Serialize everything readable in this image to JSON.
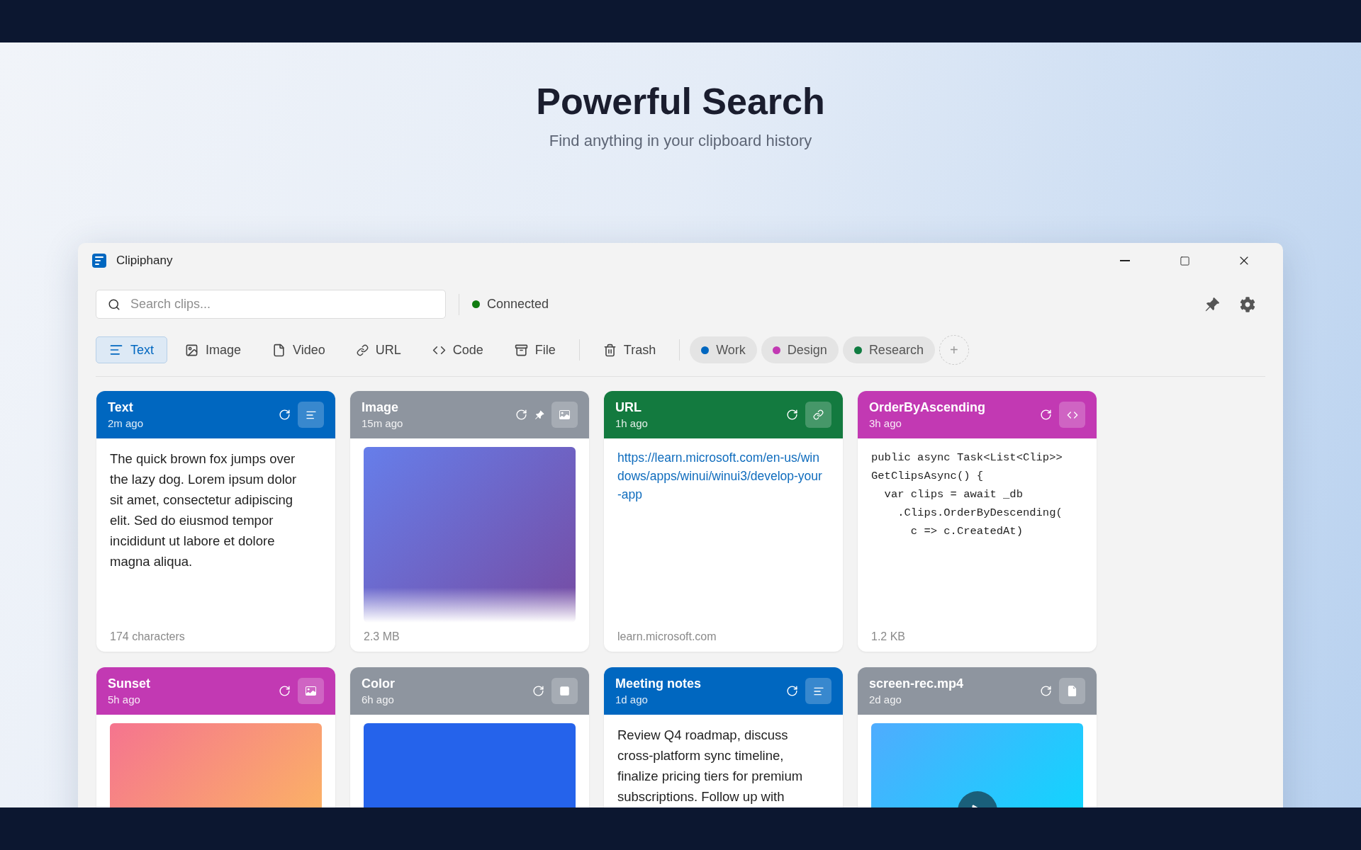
{
  "hero": {
    "title": "Powerful Search",
    "subtitle": "Find anything in your clipboard history"
  },
  "window": {
    "title": "Clipiphany"
  },
  "search": {
    "placeholder": "Search clips..."
  },
  "status": {
    "label": "Connected",
    "connected": true
  },
  "filters": [
    {
      "label": "Text",
      "kind": "text",
      "selected": true
    },
    {
      "label": "Image",
      "kind": "image",
      "selected": false
    },
    {
      "label": "Video",
      "kind": "video",
      "selected": false
    },
    {
      "label": "URL",
      "kind": "url",
      "selected": false
    },
    {
      "label": "Code",
      "kind": "code",
      "selected": false
    },
    {
      "label": "File",
      "kind": "file",
      "selected": false
    }
  ],
  "trash": {
    "label": "Trash",
    "selected": false
  },
  "tags": [
    {
      "label": "Work",
      "color": "#0067c0"
    },
    {
      "label": "Design",
      "color": "#c239b3"
    },
    {
      "label": "Research",
      "color": "#107c41"
    }
  ],
  "add_tag": {
    "label": "+"
  },
  "clips": [
    {
      "kind": "text",
      "title": "Text",
      "time": "2m ago",
      "color": "#0067c0",
      "pinned": false,
      "content": "The quick brown fox jumps over the lazy dog. Lorem ipsum dolor sit amet, consectetur adipiscing elit. Sed do eiusmod tempor incididunt ut labore et dolore magna aliqua.",
      "footer": "174 characters"
    },
    {
      "kind": "image",
      "title": "Image",
      "time": "15m ago",
      "color": "#8e959f",
      "pinned": true,
      "footer": "2.3 MB"
    },
    {
      "kind": "url",
      "title": "URL",
      "time": "1h ago",
      "color": "#137a3f",
      "pinned": false,
      "content": "https://learn.microsoft.com/en-us/windows/apps/winui/winui3/develop-your-app",
      "footer": "learn.microsoft.com"
    },
    {
      "kind": "code",
      "title": "OrderByAscending",
      "time": "3h ago",
      "color": "#c239b3",
      "pinned": false,
      "content": "public async Task<List<Clip>>\nGetClipsAsync() {\n  var clips = await _db\n    .Clips.OrderByDescending(\n      c => c.CreatedAt)",
      "footer": "1.2 KB"
    },
    {
      "kind": "image",
      "title": "Sunset",
      "time": "5h ago",
      "color": "#c239b3",
      "pinned": false
    },
    {
      "kind": "color",
      "title": "Color",
      "time": "6h ago",
      "color": "#8e959f",
      "pinned": false
    },
    {
      "kind": "text",
      "title": "Meeting notes",
      "time": "1d ago",
      "color": "#0067c0",
      "pinned": false,
      "content": "Review Q4 roadmap, discuss cross-platform sync timeline, finalize pricing tiers for premium subscriptions. Follow up with"
    },
    {
      "kind": "video",
      "title": "screen-rec.mp4",
      "time": "2d ago",
      "color": "#8e959f",
      "pinned": false
    }
  ]
}
